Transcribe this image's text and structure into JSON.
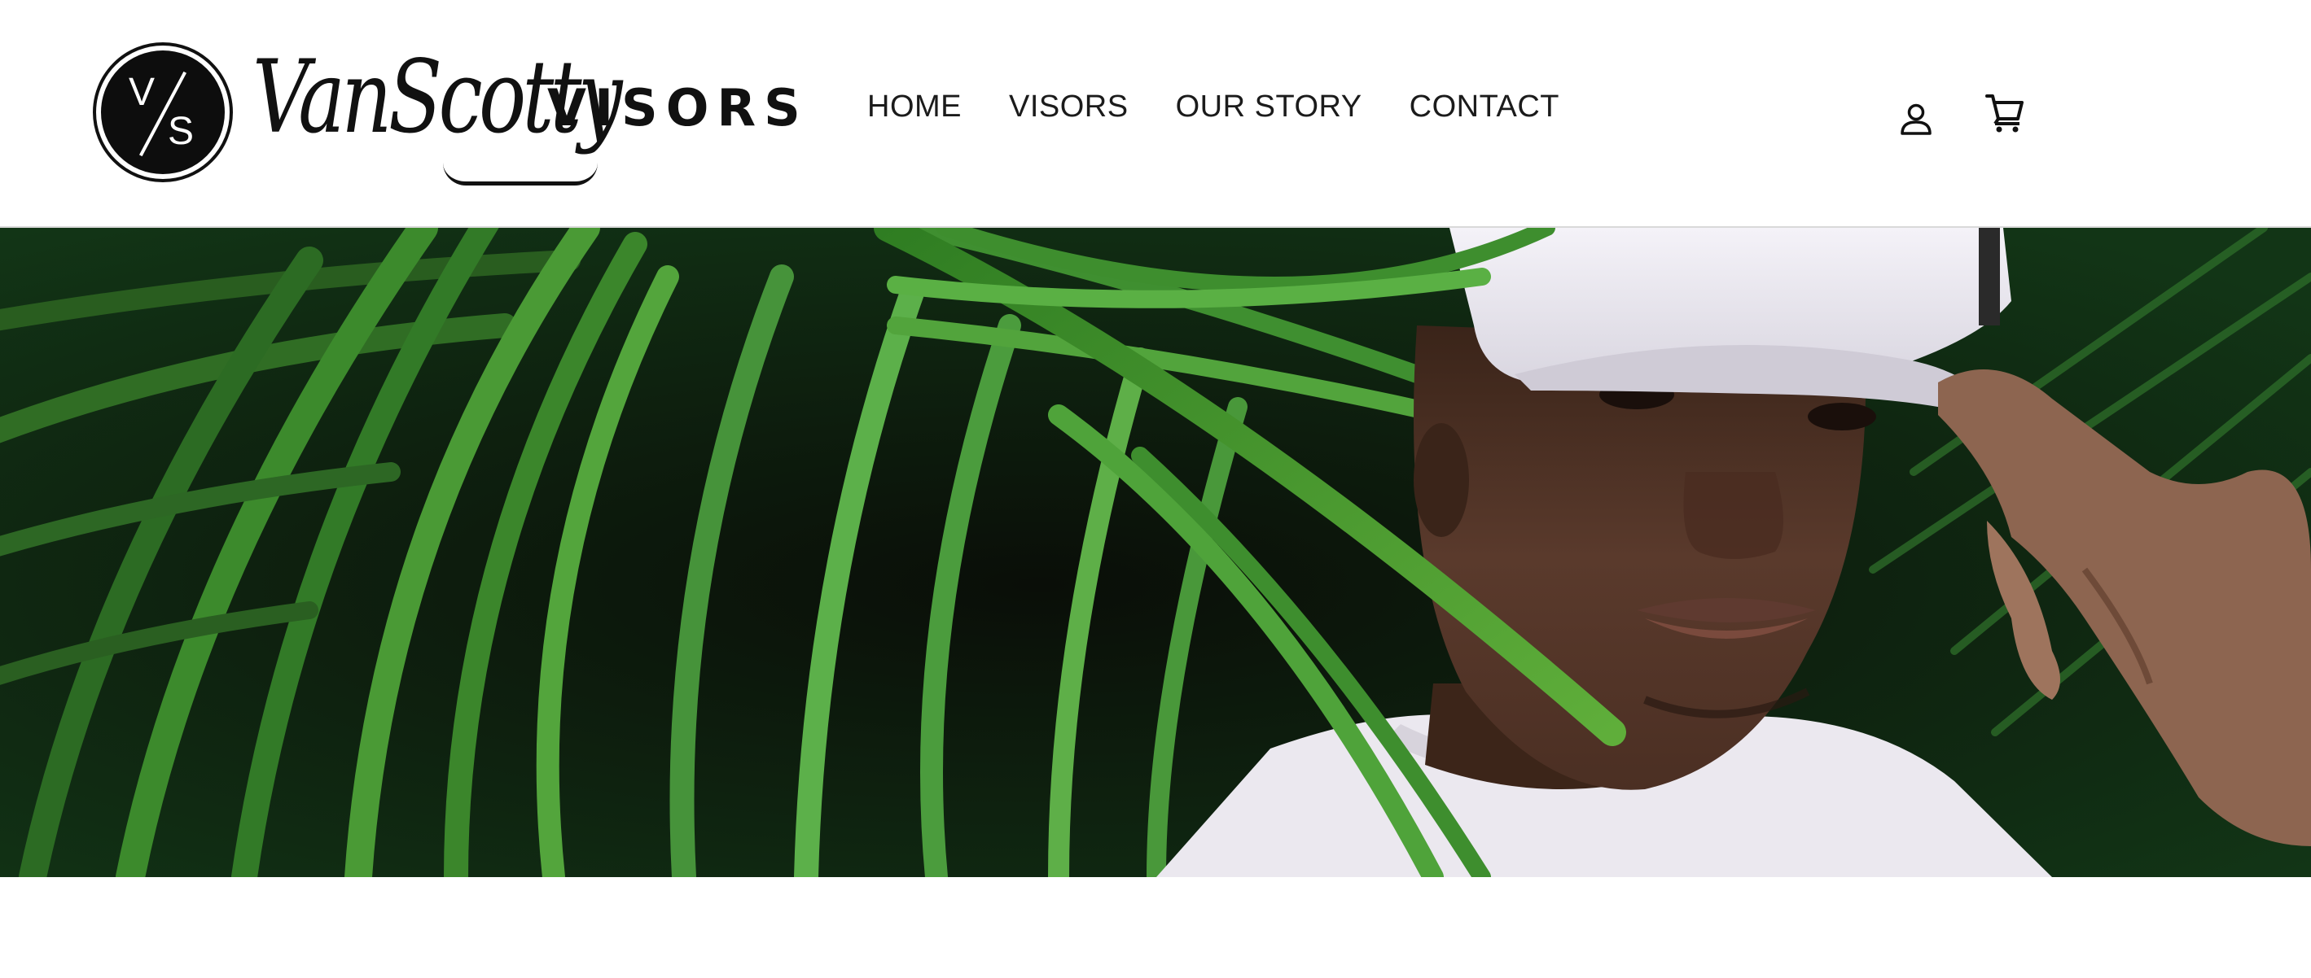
{
  "brand": {
    "logo_badge_v": "V",
    "logo_badge_s": "S",
    "logo_script": "VanScotty",
    "logo_suffix": "VISORS"
  },
  "nav": {
    "items": [
      {
        "label": "HOME"
      },
      {
        "label": "VISORS"
      },
      {
        "label": "OUR STORY"
      },
      {
        "label": "CONTACT"
      }
    ]
  },
  "header_icons": {
    "account": "account-icon",
    "cart": "cart-icon"
  },
  "hero": {
    "image": "hero-image-man-white-cap-palm-leaves"
  },
  "colors": {
    "text": "#1b1b1b",
    "leaf_green": "#3e8e2e",
    "background": "#ffffff"
  }
}
